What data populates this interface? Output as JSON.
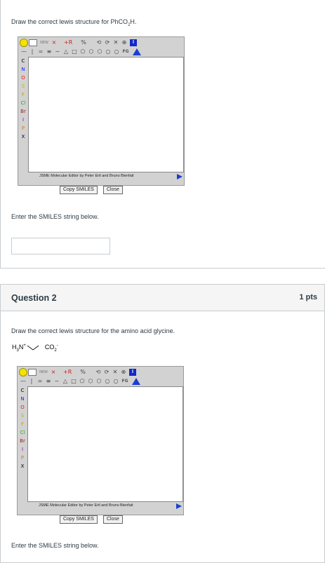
{
  "question1": {
    "prompt": "Draw the correct lewis structure for PhCO",
    "prompt_sub": "2",
    "prompt_end": "H.",
    "enter_label": "Enter the SMILES string below.",
    "smiles_value": "",
    "smiles_placeholder": ""
  },
  "question2": {
    "title": "Question 2",
    "points": "1 pts",
    "prompt": "Draw the correct lewis structure for the amino acid glycine.",
    "formula": {
      "h": "H",
      "three": "3",
      "n": "N",
      "plus": "+",
      "co": "CO",
      "two": "2",
      "minus": "-"
    },
    "enter_label": "Enter the SMILES string below."
  },
  "jsme": {
    "toolbar1": [
      "NEW",
      "×",
      "+R",
      "%",
      "⟲",
      "⟳",
      "✕",
      "⊕",
      "I"
    ],
    "toolbar2": [
      "—",
      "=",
      "≡",
      "~",
      "△",
      "□",
      "⬠",
      "⬡",
      "⬡",
      "○",
      "○",
      "FG"
    ],
    "atoms": [
      {
        "label": "C",
        "color": "#000000"
      },
      {
        "label": "N",
        "color": "#1a1aff"
      },
      {
        "label": "O",
        "color": "#e02020"
      },
      {
        "label": "S",
        "color": "#c8b400"
      },
      {
        "label": "F",
        "color": "#c8a000"
      },
      {
        "label": "Cl",
        "color": "#30a030"
      },
      {
        "label": "Br",
        "color": "#a02020"
      },
      {
        "label": "I",
        "color": "#a000a0"
      },
      {
        "label": "P",
        "color": "#d08000"
      },
      {
        "label": "X",
        "color": "#000000"
      }
    ],
    "credit": "JSME Molecular Editor by Peter Ertl and Bruno Bienfait",
    "copy_label": "Copy SMILES",
    "close_label": "Close"
  }
}
